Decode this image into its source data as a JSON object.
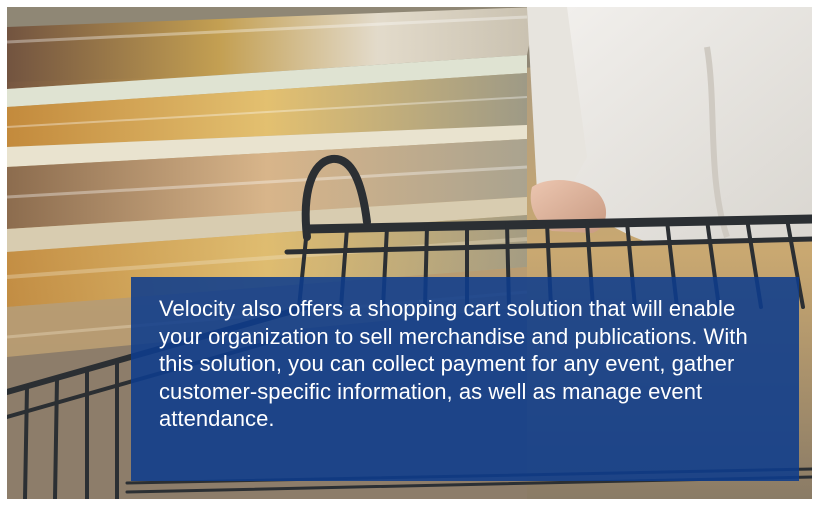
{
  "image": {
    "subject": "shopping-cart-photo",
    "colors": {
      "caption_background": "#0e3c8c",
      "caption_text": "#ffffff"
    }
  },
  "caption": {
    "text": "Velocity also offers a shopping cart solution that will enable your organization to sell merchandise and publications. With this solution, you can collect payment for any event, gather customer-specific information, as well as manage event attendance."
  }
}
